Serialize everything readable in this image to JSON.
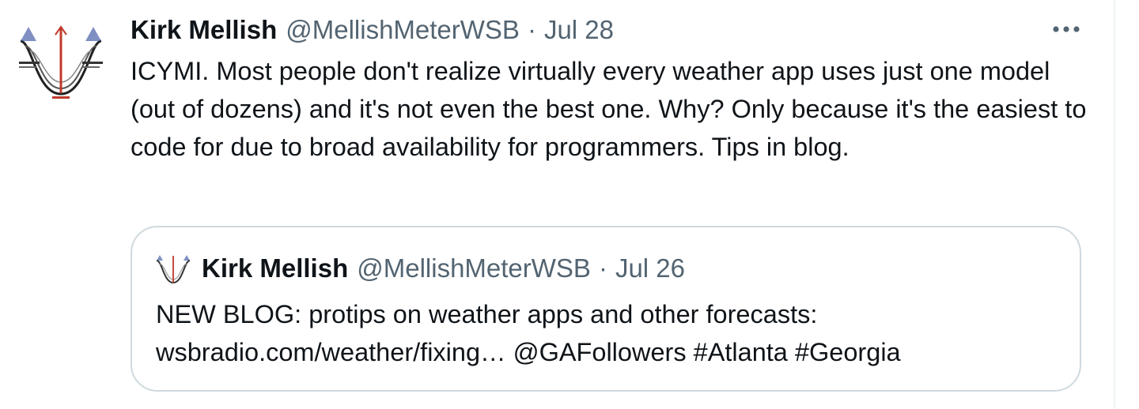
{
  "tweet": {
    "author_name": "Kirk Mellish",
    "handle": "@MellishMeterWSB",
    "separator": "·",
    "date": "Jul 28",
    "text": "ICYMI. Most people don't realize virtually every weather app uses just one model (out of dozens) and it's not even the best one. Why? Only because it's the easiest to code for due to broad availability for programmers. Tips in blog.",
    "more_icon": "more-horizontal-icon"
  },
  "quoted_tweet": {
    "author_name": "Kirk Mellish",
    "handle": "@MellishMeterWSB",
    "separator": "·",
    "date": "Jul 26",
    "text_lead": "NEW BLOG: protips on weather apps and other forecasts:",
    "link": "wsbradio.com/weather/fixing…",
    "mention": "@GAFollowers",
    "hashtag_1": "#Atlanta",
    "hashtag_2": "#Georgia"
  },
  "colors": {
    "text_primary": "#0f1419",
    "text_secondary": "#536471",
    "border": "#cfd9de"
  }
}
